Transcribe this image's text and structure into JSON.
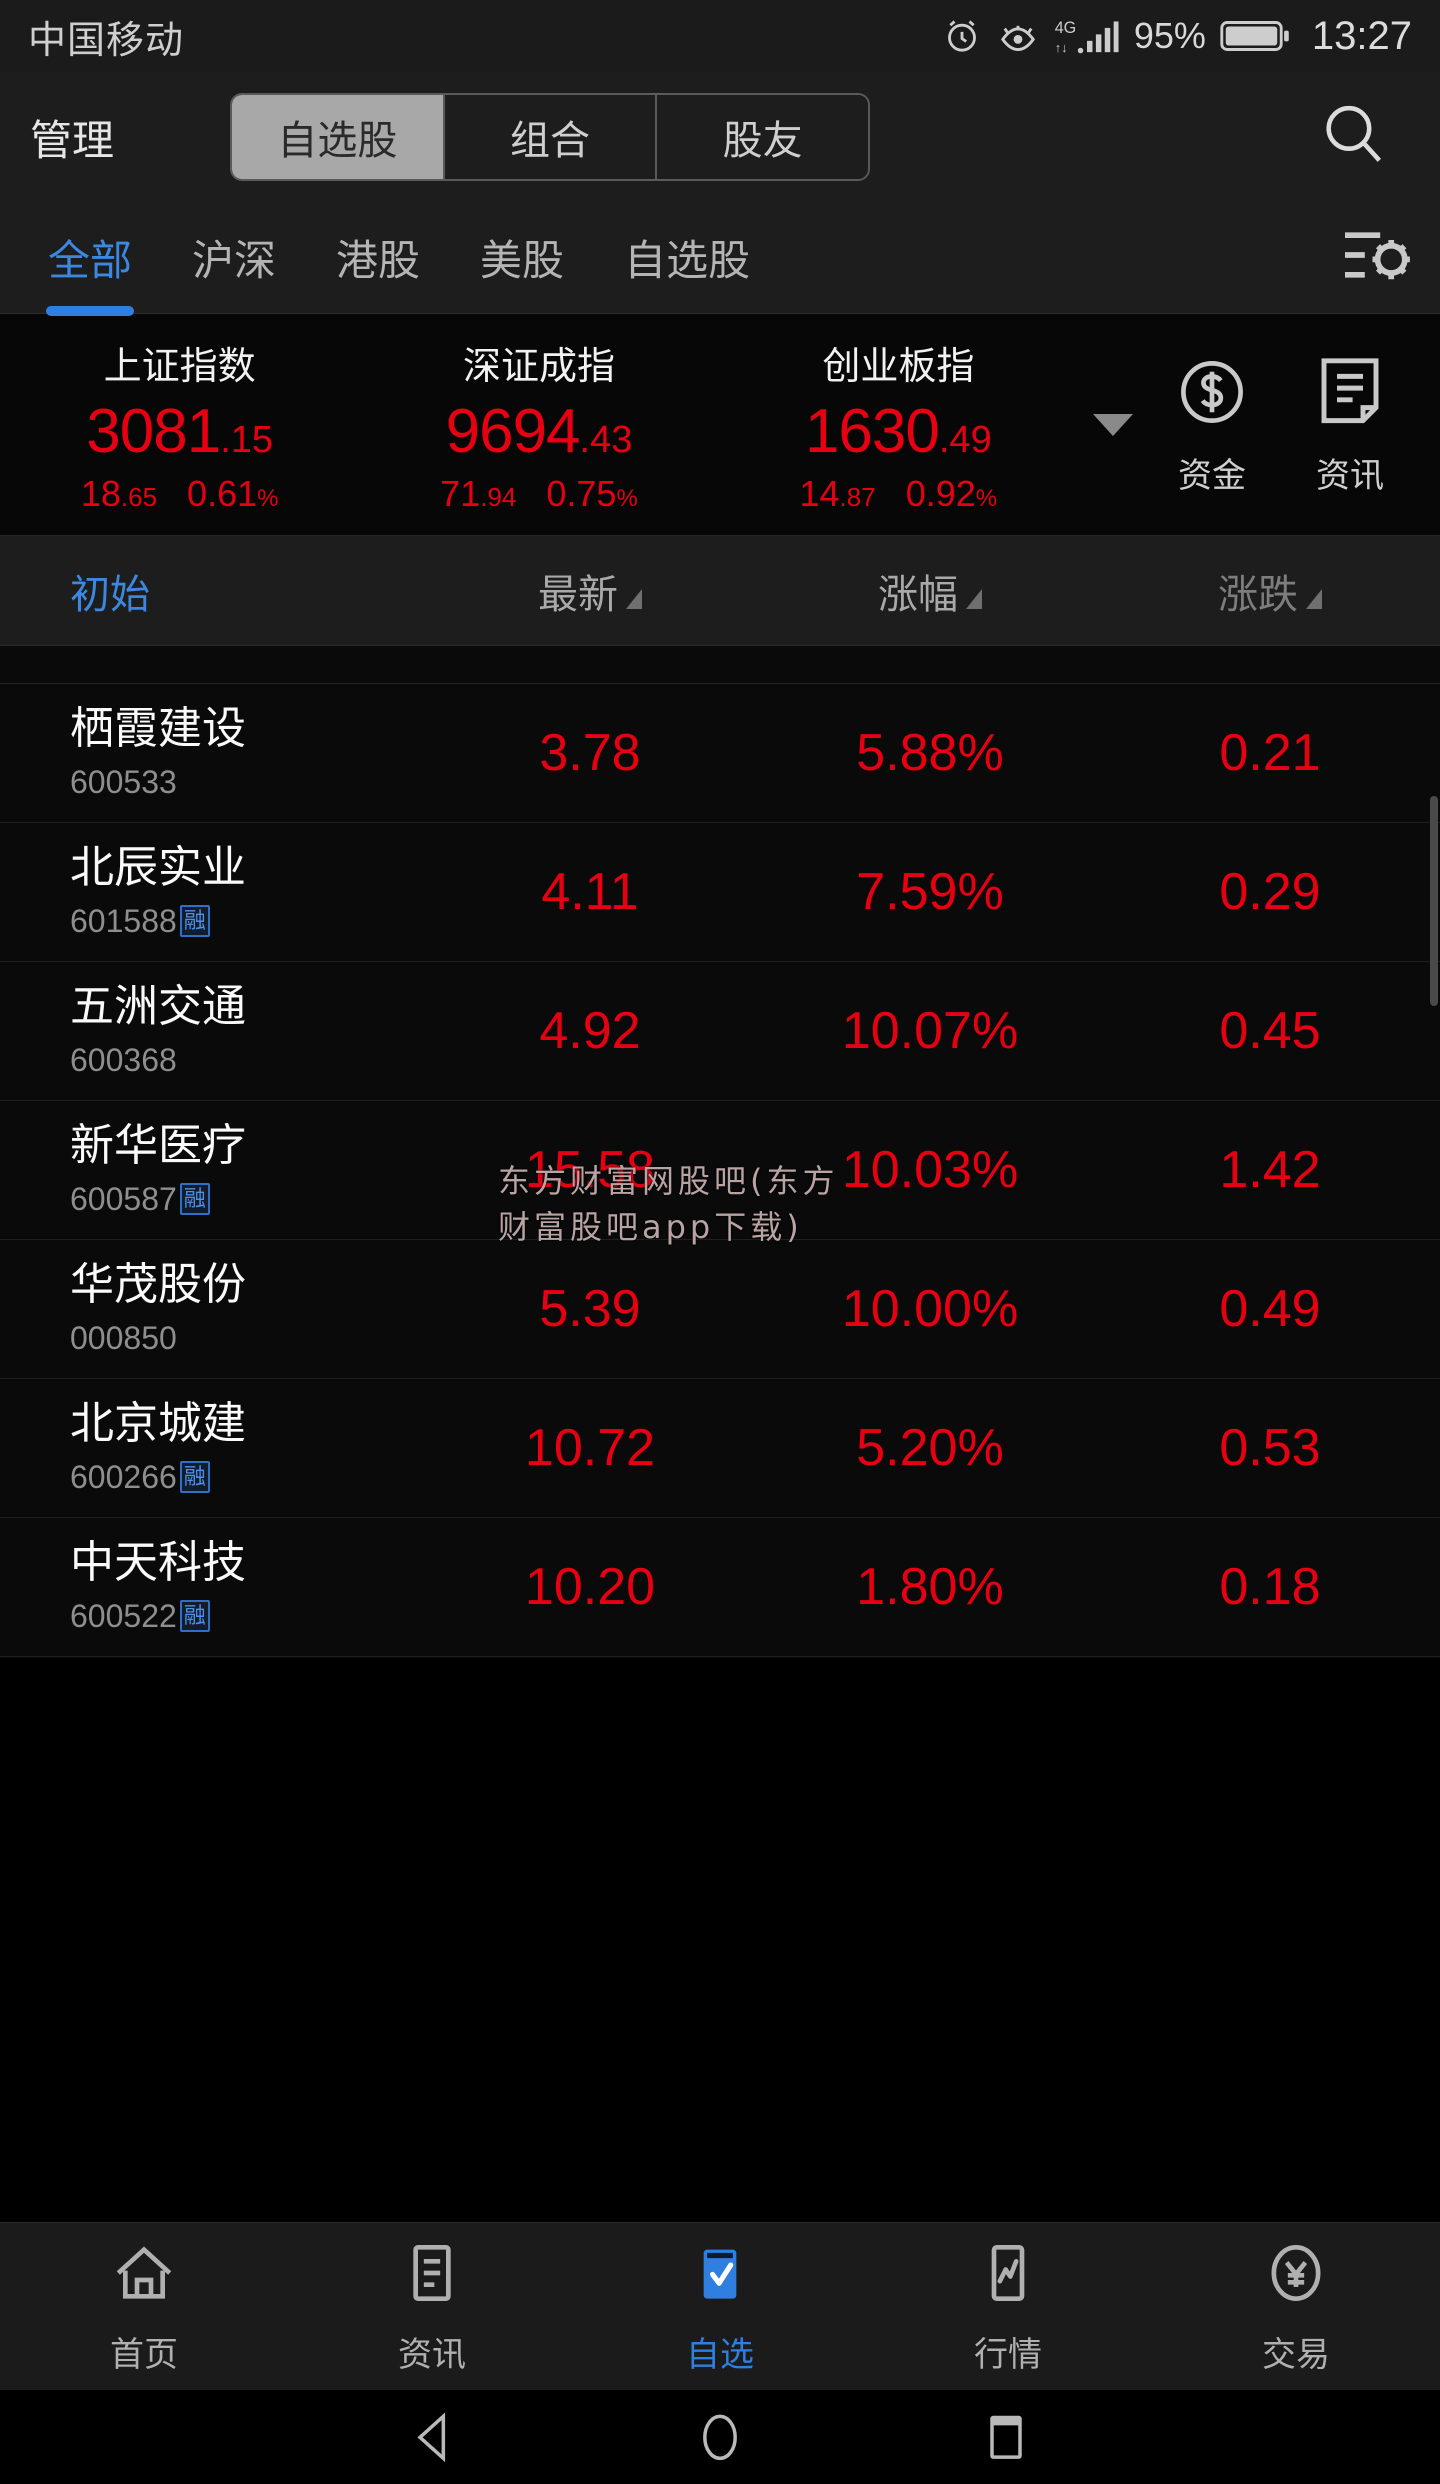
{
  "status_bar": {
    "carrier": "中国移动",
    "battery_percent": "95%",
    "time": "13:27",
    "icons": [
      "alarm-icon",
      "eye-icon",
      "4g-signal-icon",
      "battery-icon"
    ]
  },
  "top_nav": {
    "manage_label": "管理",
    "segments": [
      {
        "label": "自选股",
        "active": true
      },
      {
        "label": "组合",
        "active": false
      },
      {
        "label": "股友",
        "active": false
      }
    ],
    "search_icon": "search-icon"
  },
  "filter_tabs": {
    "items": [
      {
        "label": "全部",
        "active": true
      },
      {
        "label": "沪深",
        "active": false
      },
      {
        "label": "港股",
        "active": false
      },
      {
        "label": "美股",
        "active": false
      },
      {
        "label": "自选股",
        "active": false
      }
    ],
    "settings_icon": "sliders-gear-icon"
  },
  "indices": [
    {
      "name": "上证指数",
      "int": "3081",
      "dec": ".15",
      "change": "18",
      "change_dec": ".65",
      "pct": "0.61",
      "pct_sym": "%"
    },
    {
      "name": "深证成指",
      "int": "9694",
      "dec": ".43",
      "change": "71",
      "change_dec": ".94",
      "pct": "0.75",
      "pct_sym": "%"
    },
    {
      "name": "创业板指",
      "int": "1630",
      "dec": ".49",
      "change": "14",
      "change_dec": ".87",
      "pct": "0.92",
      "pct_sym": "%"
    }
  ],
  "index_actions": [
    {
      "label": "资金",
      "icon": "dollar-circle-icon"
    },
    {
      "label": "资讯",
      "icon": "document-icon"
    }
  ],
  "columns": [
    {
      "label": "初始",
      "sortable": false,
      "active": true
    },
    {
      "label": "最新",
      "sortable": true,
      "active": false
    },
    {
      "label": "涨幅",
      "sortable": true,
      "active": false
    },
    {
      "label": "涨跌",
      "sortable": true,
      "active": false
    }
  ],
  "stocks": [
    {
      "name": "栖霞建设",
      "code": "600533",
      "margin": "",
      "price": "3.78",
      "pct": "5.88%",
      "change": "0.21"
    },
    {
      "name": "北辰实业",
      "code": "601588",
      "margin": "融",
      "price": "4.11",
      "pct": "7.59%",
      "change": "0.29"
    },
    {
      "name": "五洲交通",
      "code": "600368",
      "margin": "",
      "price": "4.92",
      "pct": "10.07%",
      "change": "0.45"
    },
    {
      "name": "新华医疗",
      "code": "600587",
      "margin": "融",
      "price": "15.58",
      "pct": "10.03%",
      "change": "1.42"
    },
    {
      "name": "华茂股份",
      "code": "000850",
      "margin": "",
      "price": "5.39",
      "pct": "10.00%",
      "change": "0.49"
    },
    {
      "name": "北京城建",
      "code": "600266",
      "margin": "融",
      "price": "10.72",
      "pct": "5.20%",
      "change": "0.53"
    },
    {
      "name": "中天科技",
      "code": "600522",
      "margin": "融",
      "price": "10.20",
      "pct": "1.80%",
      "change": "0.18"
    }
  ],
  "watermark": {
    "line1": "东方财富网股吧(东方",
    "line2": "财富股吧app下载)"
  },
  "bottom_nav": [
    {
      "label": "首页",
      "icon": "home-icon",
      "active": false
    },
    {
      "label": "资讯",
      "icon": "news-icon",
      "active": false
    },
    {
      "label": "自选",
      "icon": "check-box-icon",
      "active": true
    },
    {
      "label": "行情",
      "icon": "chart-icon",
      "active": false
    },
    {
      "label": "交易",
      "icon": "yuan-circle-icon",
      "active": false
    }
  ],
  "android_nav": [
    {
      "icon": "back-triangle-icon"
    },
    {
      "icon": "home-circle-icon"
    },
    {
      "icon": "recents-square-icon"
    }
  ],
  "colors": {
    "up_red": "#e60012",
    "accent_blue": "#2f7fe0",
    "bg": "#0a0a0a"
  }
}
